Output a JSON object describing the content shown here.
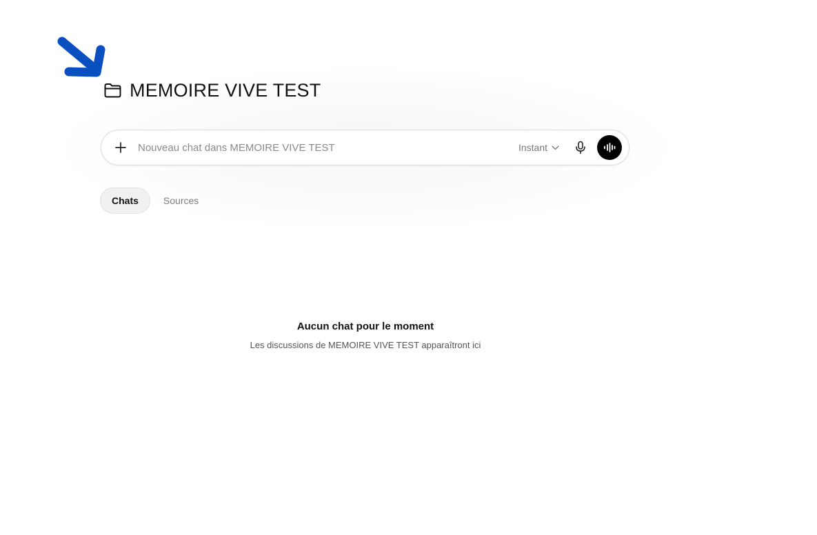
{
  "project": {
    "title": "MEMOIRE VIVE TEST"
  },
  "composer": {
    "placeholder": "Nouveau chat dans MEMOIRE VIVE TEST",
    "value": "",
    "mode_label": "Instant",
    "icons": {
      "add": "plus-icon",
      "mode_dropdown": "chevron-down-icon",
      "dictate": "microphone-icon",
      "voice": "voice-waveform-icon"
    }
  },
  "tabs": [
    {
      "label": "Chats",
      "active": true
    },
    {
      "label": "Sources",
      "active": false
    }
  ],
  "empty_state": {
    "title": "Aucun chat pour le moment",
    "subtitle": "Les discussions de MEMOIRE VIVE TEST apparaîtront ici"
  },
  "annotation": {
    "icon": "arrow-annotation",
    "color": "#0a4fc0"
  },
  "colors": {
    "voice_button": "#000000",
    "active_tab_bg": "#f1f1f1"
  }
}
